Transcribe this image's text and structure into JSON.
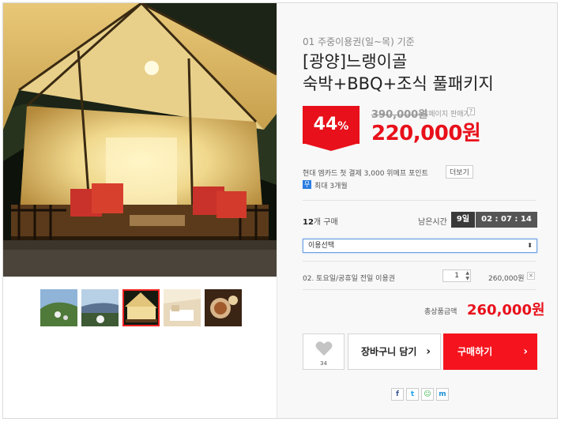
{
  "product": {
    "subtitle": "01 주중이용권(일~목) 기준",
    "title_line1": "[광양]느랭이골",
    "title_line2": "숙박+BBQ+조식 풀패키지"
  },
  "pricing": {
    "discount_number": "44",
    "discount_unit": "%",
    "original_price": "390,000원",
    "price_note": "홈페이지 판매가",
    "help_label": "?",
    "sale_price": "220,000원"
  },
  "benefits": {
    "card_text": "현대 엠카드 첫 결제 3,000 위메프 포인트",
    "more_label": "더보기",
    "installment_badge": "무",
    "installment_text": "최대 3개월"
  },
  "status": {
    "sold_count": "12",
    "sold_suffix": "개 구매",
    "remain_label": "남은시간",
    "days": "9일",
    "time": "02 : 07 : 14"
  },
  "option_select": {
    "selected": "이용선택",
    "arrow": "⬍"
  },
  "selected_option": {
    "name": "02. 토요일/공휴일 전일 이용권",
    "quantity": "1",
    "price": "260,000원",
    "remove": "×"
  },
  "total": {
    "label": "총상품금액",
    "price": "260,000원"
  },
  "actions": {
    "like_count": "34",
    "cart_label": "장바구니 담기",
    "buy_label": "구매하기",
    "arrow": "›"
  },
  "share": {
    "facebook": "f",
    "twitter": "t",
    "kakao": "☺",
    "me2day": "m"
  },
  "colors": {
    "accent": "#e8101a",
    "buy_button": "#f5141e",
    "timer_dark": "#3a3a3a"
  }
}
